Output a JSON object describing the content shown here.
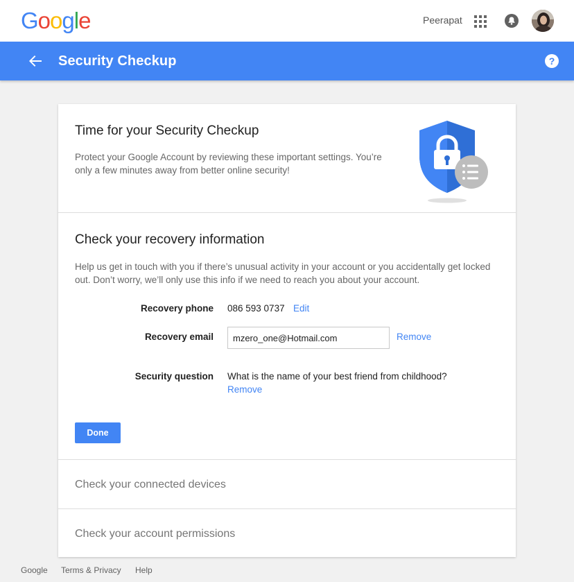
{
  "topbar": {
    "logo_letters": [
      "G",
      "o",
      "o",
      "g",
      "l",
      "e"
    ],
    "logo_colors": [
      "#4285f4",
      "#ea4335",
      "#fbbc05",
      "#4285f4",
      "#34a853",
      "#ea4335"
    ],
    "user_name": "Peerapat",
    "icons": [
      "apps-grid-icon",
      "notifications-bell-icon",
      "avatar"
    ]
  },
  "appbar": {
    "title": "Security Checkup",
    "color": "#4285f4",
    "icons": [
      "back-arrow-icon",
      "help-icon"
    ]
  },
  "intro": {
    "title": "Time for your Security Checkup",
    "text": "Protect your Google Account by reviewing these important settings. You’re only a few minutes away from better online security!",
    "illustration": "shield-lock-icon"
  },
  "recovery": {
    "title": "Check your recovery information",
    "text": "Help us get in touch with you if there’s unusual activity in your account or you accidentally get locked out. Don’t worry, we’ll only use this info if we need to reach you about your account.",
    "phone_label": "Recovery phone",
    "phone_value": "086 593 0737",
    "phone_edit": "Edit",
    "email_label": "Recovery email",
    "email_value": "mzero_one@Hotmail.com",
    "email_remove": "Remove",
    "question_label": "Security question",
    "question_value": "What is the name of your best friend from childhood?",
    "question_remove": "Remove",
    "done_label": "Done"
  },
  "devices": {
    "title": "Check your connected devices"
  },
  "permissions": {
    "title": "Check your account permissions"
  },
  "footer": {
    "google": "Google",
    "terms": "Terms & Privacy",
    "help": "Help"
  }
}
